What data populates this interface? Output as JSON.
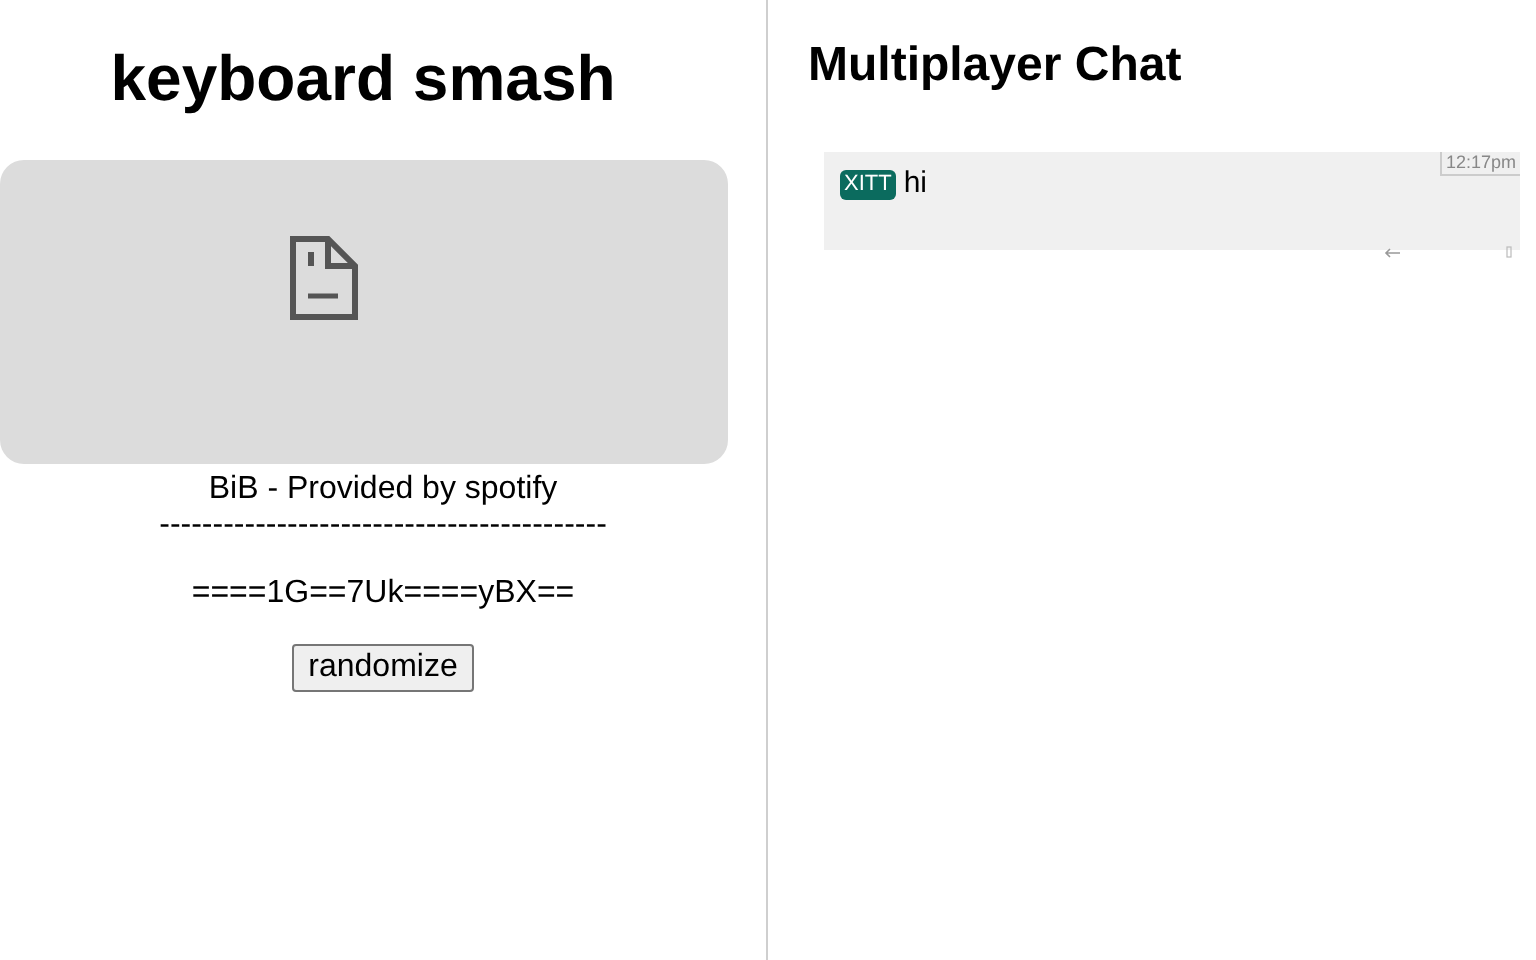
{
  "left": {
    "title": "keyboard smash",
    "caption": "BiB - Provided by spotify",
    "divider": "------------------------------------------",
    "code": "====1G==7Uk====yBX==",
    "button": "randomize"
  },
  "chat": {
    "title": "Multiplayer Chat",
    "messages": [
      {
        "user": "XITT",
        "color": "#0b6b5e",
        "text": "hi",
        "time": "12:17pm"
      }
    ]
  }
}
